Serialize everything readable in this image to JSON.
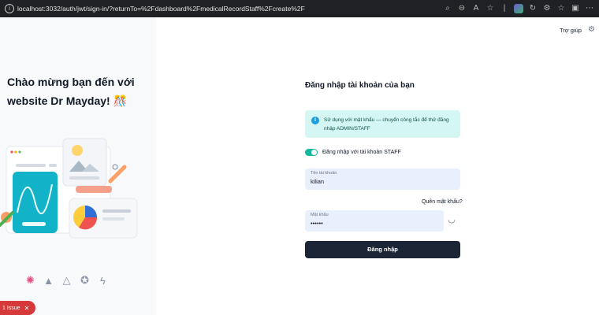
{
  "browser": {
    "url": "localhost:3032/auth/jwt/sign-in/?returnTo=%2Fdashboard%2FmedicalRecordStaff%2Fcreate%2F"
  },
  "left": {
    "welcome": "Chào mừng bạn đến với website Dr Mayday! 🎊"
  },
  "header": {
    "help": "Trợ giúp"
  },
  "form": {
    "title": "Đăng nhập tài khoản của bạn",
    "alert": "Sử dụng với mật khẩu — chuyển công tắc để thử đăng nhập ADMIN/STAFF",
    "toggle_label": "Đăng nhập với tài khoản STAFF",
    "username_label": "Tên tài khoản",
    "username_value": "kilian",
    "forgot": "Quên mật khẩu?",
    "password_label": "Mật khẩu",
    "password_value": "••••••",
    "submit": "Đăng nhập"
  },
  "issue": {
    "label": "1 Issue",
    "close": "✕"
  },
  "colors": {
    "accent": "#15b79e",
    "button": "#1c2536",
    "alert_bg": "#d4f7f4",
    "field_bg": "#e8f0fe",
    "issue_bg": "#d63939"
  }
}
